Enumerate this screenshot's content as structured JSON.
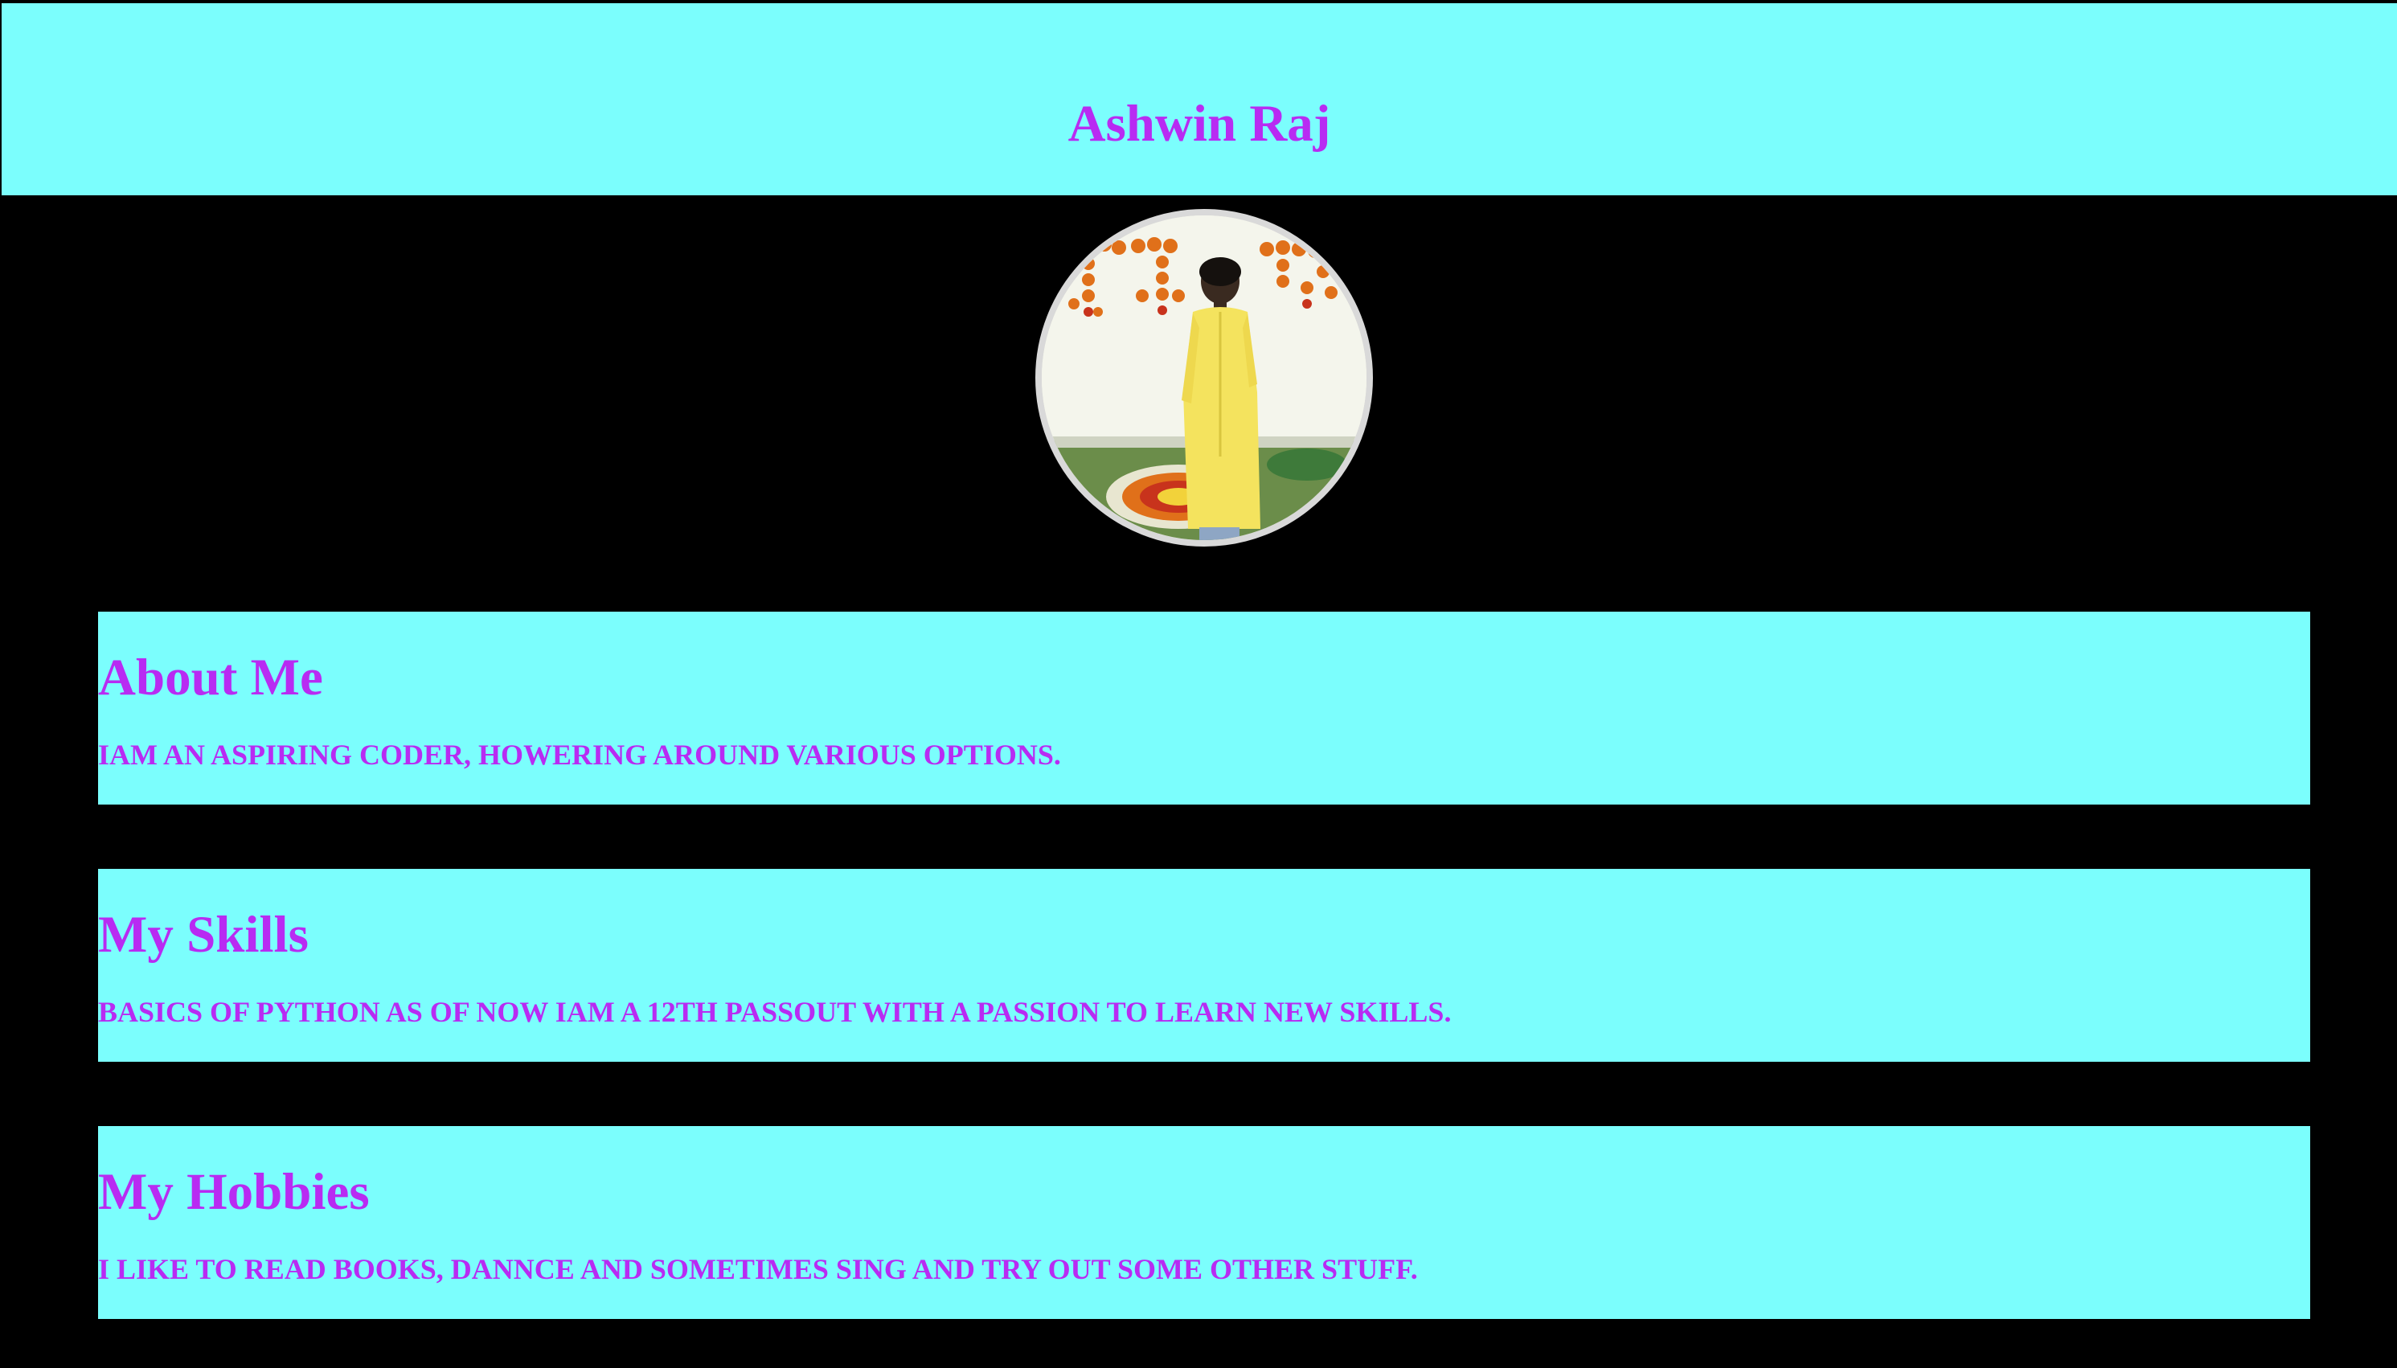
{
  "header": {
    "title": "Ashwin Raj"
  },
  "profile": {
    "photo_icon": "profile-photo"
  },
  "sections": {
    "about": {
      "heading": "About Me",
      "text": "IAM AN ASPIRING CODER, HOWERING AROUND VARIOUS OPTIONS."
    },
    "skills": {
      "heading": "My Skills",
      "text": "BASICS OF PYTHON AS OF NOW IAM A 12TH PASSOUT WITH A PASSION TO LEARN NEW SKILLS."
    },
    "hobbies": {
      "heading": "My Hobbies",
      "text": "I LIKE TO READ BOOKS, DANNCE AND SOMETIMES SING AND TRY OUT SOME OTHER STUFF."
    }
  },
  "colors": {
    "background": "#000000",
    "panel": "#7bfefd",
    "text": "#b82bf2",
    "avatar_border": "#d9d9d9"
  }
}
